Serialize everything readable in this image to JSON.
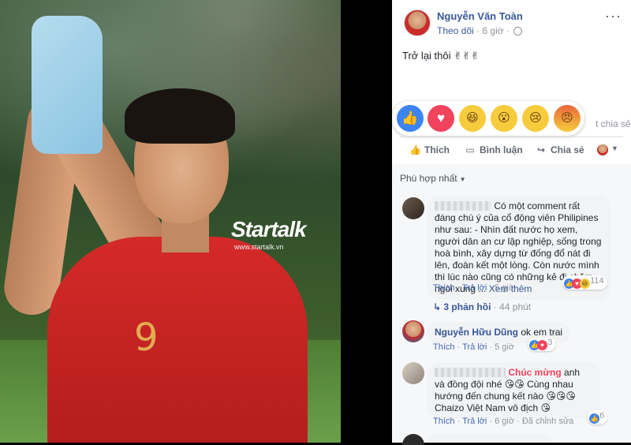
{
  "photo": {
    "watermark": "Startalk",
    "watermark_url": "www.startalk.vn",
    "jersey_number": "9"
  },
  "post": {
    "author": "Nguyễn Văn Toàn",
    "follow_label": "Theo dõi",
    "time": "6 giờ",
    "more": "···",
    "text": "Trở lại thôi ✌✌✌"
  },
  "reactions": [
    "like",
    "love",
    "haha",
    "wow",
    "sad",
    "angry"
  ],
  "share_count": "t chia sẻ",
  "actions": {
    "like": "Thích",
    "comment": "Bình luận",
    "share": "Chia sẻ"
  },
  "comments_sort": "Phù hợp nhất",
  "comments": [
    {
      "text": "Có một comment rất đáng chú ý của cổ động viên Philipines như sau: - Nhìn đất nước họ xem, người dân an cư lập nghiệp, sống trong hoà bình, xây dựng từ đống đổ nát đi lên, đoàn kết một lòng. Còn nước mình thì lúc nào cũng có những kẻ đi chăm ngòi xung ...",
      "see_more": "Xem thêm",
      "like_label": "Thích",
      "reply_label": "Trả lời",
      "time": "5 giờ",
      "reaction_count": "114",
      "replies_label": "3 phản hồi",
      "replies_time": "44 phút"
    },
    {
      "author": "Nguyễn Hữu Dũng",
      "text": "ok em trai",
      "like_label": "Thích",
      "reply_label": "Trả lời",
      "time": "5 giờ",
      "reaction_count": "3"
    },
    {
      "highlight": "Chúc mừng",
      "text": "anh và đồng đội nhé 😘😘 Cùng nhau hướng đến chung kết nào 😘😘😘 Chaizo Việt Nam vô địch 😘",
      "like_label": "Thích",
      "reply_label": "Trả lời",
      "time": "6 giờ",
      "edited": "Đã chỉnh sửa",
      "reaction_count": "6"
    }
  ]
}
